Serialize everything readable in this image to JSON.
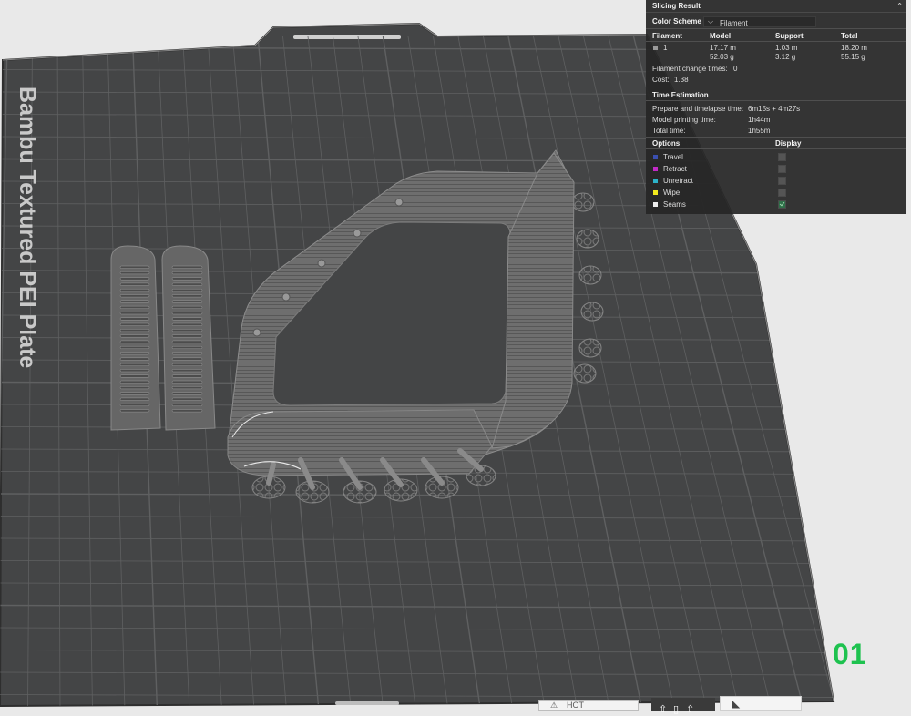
{
  "plate": {
    "label": "Bambu Textured PEI Plate",
    "number": "01"
  },
  "panel": {
    "title": "Slicing Result",
    "color_scheme_label": "Color Scheme",
    "color_scheme_value": "Filament",
    "table": {
      "headers": [
        "Filament",
        "Model",
        "Support",
        "Total"
      ],
      "rows": [
        {
          "filament": "1",
          "model_length": "17.17 m",
          "model_weight": "52.03 g",
          "support_length": "1.03 m",
          "support_weight": "3.12 g",
          "total_length": "18.20 m",
          "total_weight": "55.15 g"
        }
      ]
    },
    "filament_change_label": "Filament change times:",
    "filament_change_value": "0",
    "cost_label": "Cost:",
    "cost_value": "1.38",
    "time_title": "Time Estimation",
    "prepare_label": "Prepare and timelapse time:",
    "prepare_value": "6m15s + 4m27s",
    "model_time_label": "Model printing time:",
    "model_time_value": "1h44m",
    "total_time_label": "Total time:",
    "total_time_value": "1h55m",
    "options_header": "Options",
    "display_header": "Display",
    "options": [
      {
        "label": "Travel",
        "color": "#3a4fb0",
        "checked": false
      },
      {
        "label": "Retract",
        "color": "#c22ac7",
        "checked": false
      },
      {
        "label": "Unretract",
        "color": "#2cb3c9",
        "checked": false
      },
      {
        "label": "Wipe",
        "color": "#f2e91e",
        "checked": false
      },
      {
        "label": "Seams",
        "color": "#eeeeee",
        "checked": true
      }
    ]
  },
  "toolbar": {
    "layer_text": "HOT"
  },
  "colors": {
    "bed": "#444546",
    "grid": "#5f6061",
    "model": "#6d6d6d",
    "accent": "#1ec24f"
  }
}
